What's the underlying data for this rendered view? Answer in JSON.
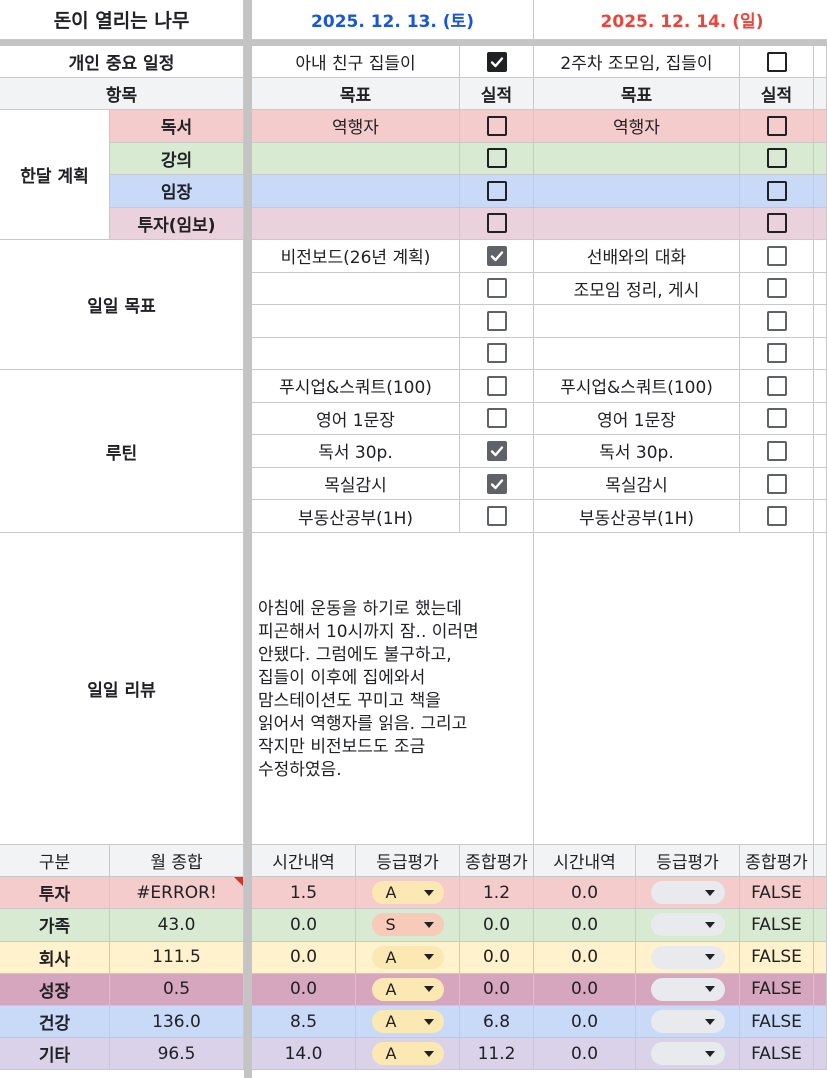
{
  "title": "돈이 열리는 나무",
  "dates": [
    {
      "text": "2025. 12. 13. (토)",
      "color": "#1a56db"
    },
    {
      "text": "2025. 12. 14. (일)",
      "color": "#e8453c"
    }
  ],
  "important": {
    "label": "개인 중요 일정",
    "day1": {
      "text": "아내 친구 집들이",
      "checked": true
    },
    "day2": {
      "text": "2주차 조모임, 집들이",
      "checked": false
    }
  },
  "headers": {
    "item": "항목",
    "goal": "목표",
    "result": "실적"
  },
  "monthly": {
    "label": "한달 계획",
    "rows": [
      {
        "name": "독서",
        "color": "#f4cccc",
        "day1": "역행자",
        "day2": "역행자"
      },
      {
        "name": "강의",
        "color": "#d9ead3",
        "day1": "",
        "day2": ""
      },
      {
        "name": "임장",
        "color": "#c9daf8",
        "day1": "",
        "day2": ""
      },
      {
        "name": "투자(임보)",
        "color": "#ead1dc",
        "day1": "",
        "day2": ""
      }
    ]
  },
  "daily_goals": {
    "label": "일일 목표",
    "rows": [
      {
        "day1": "비전보드(26년 계획)",
        "c1": true,
        "day2": "선배와의 대화",
        "c2": false
      },
      {
        "day1": "",
        "c1": false,
        "day2": "조모임 정리, 게시",
        "c2": false
      },
      {
        "day1": "",
        "c1": false,
        "day2": "",
        "c2": false
      },
      {
        "day1": "",
        "c1": false,
        "day2": "",
        "c2": false
      }
    ]
  },
  "routine": {
    "label": "루틴",
    "rows": [
      {
        "day1": "푸시업&스쿼트(100)",
        "c1": false,
        "day2": "푸시업&스쿼트(100)",
        "c2": false
      },
      {
        "day1": "영어 1문장",
        "c1": false,
        "day2": "영어 1문장",
        "c2": false
      },
      {
        "day1": "독서 30p.",
        "c1": true,
        "day2": "독서 30p.",
        "c2": false
      },
      {
        "day1": "목실감시",
        "c1": true,
        "day2": "목실감시",
        "c2": false
      },
      {
        "day1": "부동산공부(1H)",
        "c1": false,
        "day2": "부동산공부(1H)",
        "c2": false
      }
    ]
  },
  "review": {
    "label": "일일 리뷰",
    "day1": "아침에 운동을 하기로 했는데\n피곤해서 10시까지 잠.. 이러면\n안됐다. 그럼에도 불구하고,\n집들이 이후에 집에와서\n맘스테이션도 꾸미고 책을\n읽어서 역행자를 읽음. 그리고\n작지만 비전보드도 조금\n수정하였음.",
    "day2": ""
  },
  "summary": {
    "headers": {
      "category": "구분",
      "monthly_total": "월 종합",
      "time": "시간내역",
      "grade": "등급평가",
      "overall": "종합평가"
    },
    "rows": [
      {
        "category": "투자",
        "color": "#f4cccc",
        "total": "#ERROR!",
        "t1": "1.5",
        "g1": "A",
        "o1": "1.2",
        "t2": "0.0",
        "o2": "FALSE",
        "pill": "#fce8b2"
      },
      {
        "category": "가족",
        "color": "#d9ead3",
        "total": "43.0",
        "t1": "0.0",
        "g1": "S",
        "o1": "0.0",
        "t2": "0.0",
        "o2": "FALSE",
        "pill": "#f7cbb7"
      },
      {
        "category": "회사",
        "color": "#fff2cc",
        "total": "111.5",
        "t1": "0.0",
        "g1": "A",
        "o1": "0.0",
        "t2": "0.0",
        "o2": "FALSE",
        "pill": "#fce8b2"
      },
      {
        "category": "성장",
        "color": "#d5a6bd",
        "total": "0.5",
        "t1": "0.0",
        "g1": "A",
        "o1": "0.0",
        "t2": "0.0",
        "o2": "FALSE",
        "pill": "#fce8b2"
      },
      {
        "category": "건강",
        "color": "#c9daf8",
        "total": "136.0",
        "t1": "8.5",
        "g1": "A",
        "o1": "6.8",
        "t2": "0.0",
        "o2": "FALSE",
        "pill": "#fce8b2"
      },
      {
        "category": "기타",
        "color": "#d9d2e9",
        "total": "96.5",
        "t1": "14.0",
        "g1": "A",
        "o1": "11.2",
        "t2": "0.0",
        "o2": "FALSE",
        "pill": "#fce8b2"
      }
    ]
  }
}
